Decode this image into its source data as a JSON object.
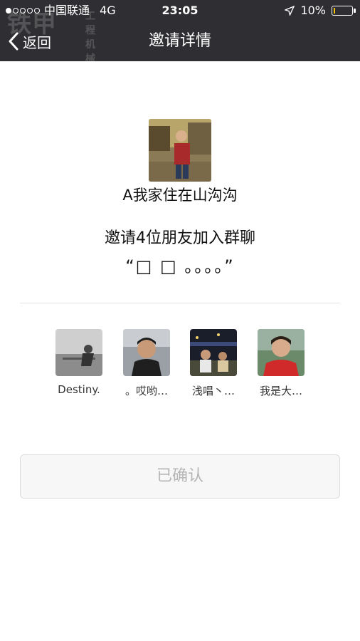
{
  "status_bar": {
    "carrier": "中国联通",
    "network": "4G",
    "time": "23:05",
    "battery": "10%",
    "battery_level": 0.1
  },
  "watermark": {
    "text": "铁甲",
    "sub_text": "工程机械网"
  },
  "nav": {
    "back_label": "返回",
    "title": "邀请详情"
  },
  "inviter": {
    "name": "A我家住在山沟沟"
  },
  "invite": {
    "text": "邀请4位朋友加入群聊",
    "group_name": "“□ □ 。。。。”"
  },
  "members": [
    {
      "name": "Destiny."
    },
    {
      "name": "。哎哟…"
    },
    {
      "name": "浅唱丶…"
    },
    {
      "name": "我是大…"
    }
  ],
  "confirm_button": {
    "label": "已确认"
  },
  "colors": {
    "header_bg": "#2f2f33",
    "battery_fill": "#f2c200",
    "disabled_text": "#b5b5b5"
  }
}
